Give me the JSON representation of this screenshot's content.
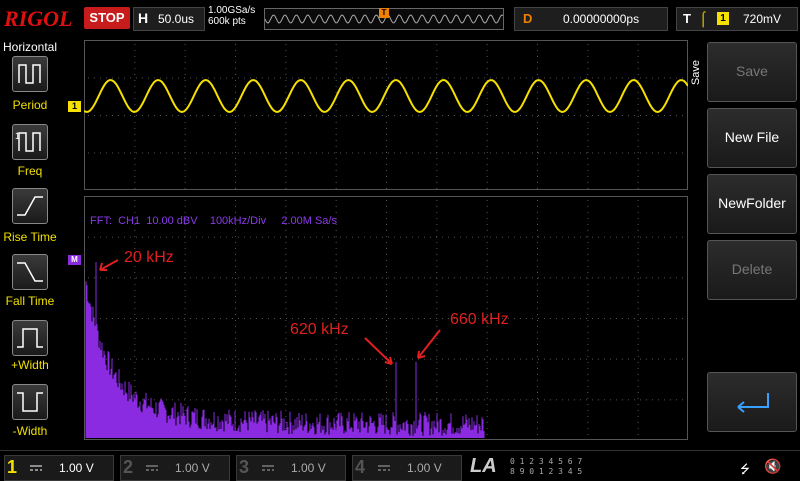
{
  "brand": "RIGOL",
  "run_state": "STOP",
  "horizontal": {
    "letter": "H",
    "timebase": "50.0us",
    "sample_rate": "1.00GSa/s",
    "memory_depth": "600k pts"
  },
  "delay": {
    "letter": "D",
    "value": "0.00000000ps"
  },
  "trigger": {
    "letter": "T",
    "edge_icon": "rising-edge-icon",
    "source": "1",
    "level": "720mV"
  },
  "left_menu": {
    "title": "Horizontal",
    "items": [
      {
        "label": "Period",
        "icon": "period-icon"
      },
      {
        "label": "Freq",
        "icon": "freq-icon"
      },
      {
        "label": "Rise Time",
        "icon": "rise-time-icon"
      },
      {
        "label": "Fall Time",
        "icon": "fall-time-icon"
      },
      {
        "label": "+Width",
        "icon": "pos-width-icon"
      },
      {
        "label": "-Width",
        "icon": "neg-width-icon"
      }
    ]
  },
  "channel_marker": "1",
  "math_marker": "M",
  "fft_info": "FFT:  CH1  10.00 dBV    100kHz/Div     2.00M Sa/s",
  "annotations": {
    "peak1": "20 kHz",
    "peak2": "620 kHz",
    "peak3": "660 kHz"
  },
  "right_menu": {
    "title": "Save",
    "buttons": [
      {
        "label": "Save",
        "enabled": false
      },
      {
        "label": "New File",
        "enabled": true
      },
      {
        "label": "NewFolder",
        "enabled": true
      },
      {
        "label": "Delete",
        "enabled": false
      },
      {
        "label": "",
        "icon": "enter-return-icon",
        "enabled": true
      }
    ]
  },
  "channels": [
    {
      "num": "1",
      "value": "1.00 V",
      "color": "#f5e000"
    },
    {
      "num": "2",
      "value": "1.00 V",
      "color": "#20c0e0"
    },
    {
      "num": "3",
      "value": "1.00 V",
      "color": "#e040c0"
    },
    {
      "num": "4",
      "value": "1.00 V",
      "color": "#2060ff"
    }
  ],
  "la": {
    "label": "LA",
    "row1": "0 1 2 3  4 5 6 7",
    "row2": "8 9 0 1  2 3 4 5"
  },
  "colors": {
    "ch1": "#f5e000",
    "fft": "#8a2be2",
    "annotation": "#e02020",
    "trigger": "#f08000",
    "grid": "#555555"
  }
}
